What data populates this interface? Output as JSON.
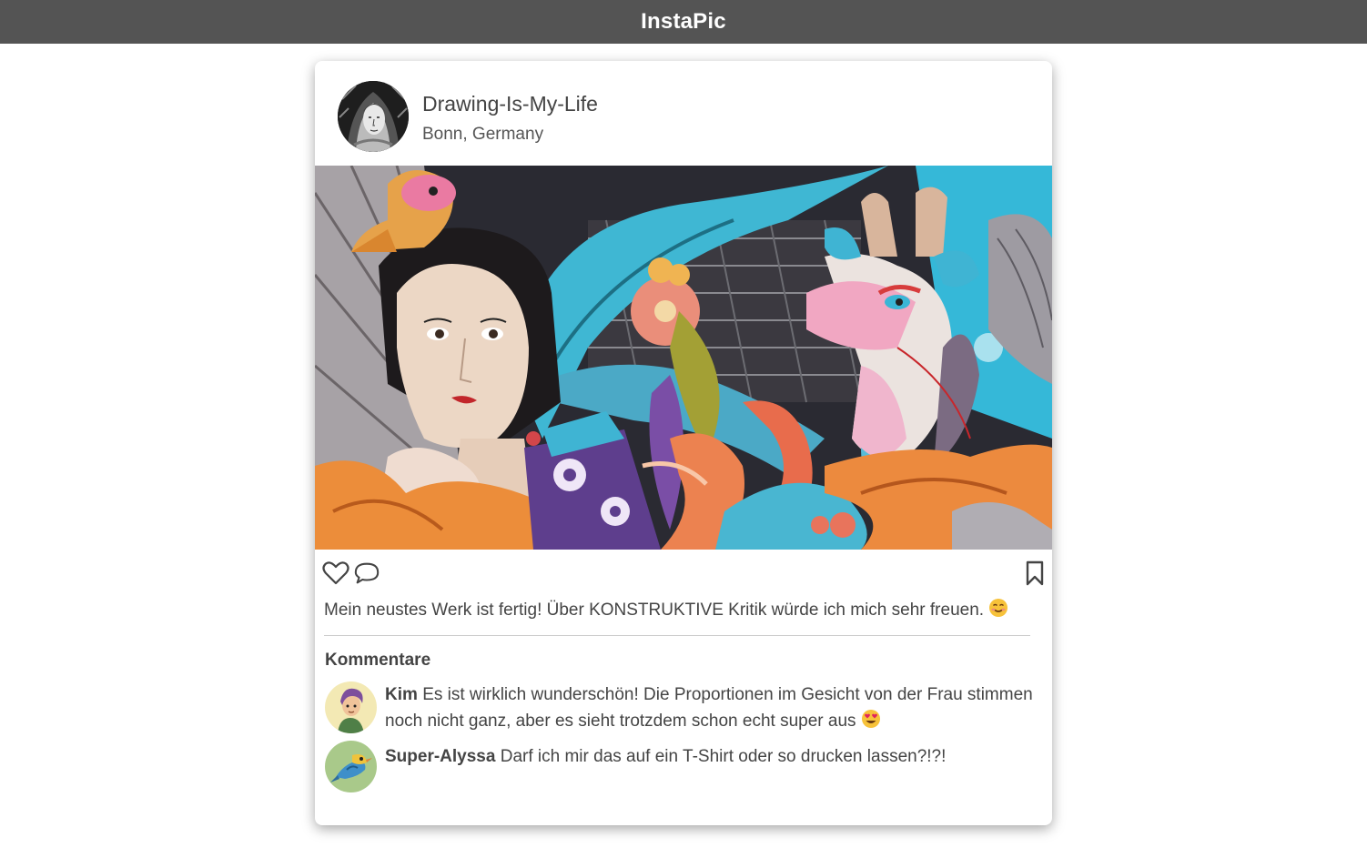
{
  "app": {
    "title": "InstaPic"
  },
  "post": {
    "username": "Drawing-Is-My-Life",
    "location": "Bonn, Germany",
    "caption": "Mein neustes Werk ist fertig! Über KONSTRUKTIVE Kritik würde ich mich sehr freuen.",
    "caption_emoji": "smiling-face-emoji"
  },
  "actions": {
    "like_icon": "heart-icon",
    "comment_icon": "speech-bubble-icon",
    "save_icon": "bookmark-icon"
  },
  "comments": {
    "heading": "Kommentare",
    "items": [
      {
        "author": "Kim",
        "text": "Es ist wirklich wunderschön! Die Proportionen im Gesicht von der Frau stimmen noch nicht ganz, aber es sieht trotzdem schon echt super aus",
        "emoji": "heart-eyes-emoji"
      },
      {
        "author": "Super-Alyssa",
        "text": "Darf ich mir das auf ein T-Shirt oder so drucken lassen?!?!"
      }
    ]
  },
  "colors": {
    "topbar": "#545454",
    "text": "#444444",
    "divider": "#cccccc"
  }
}
